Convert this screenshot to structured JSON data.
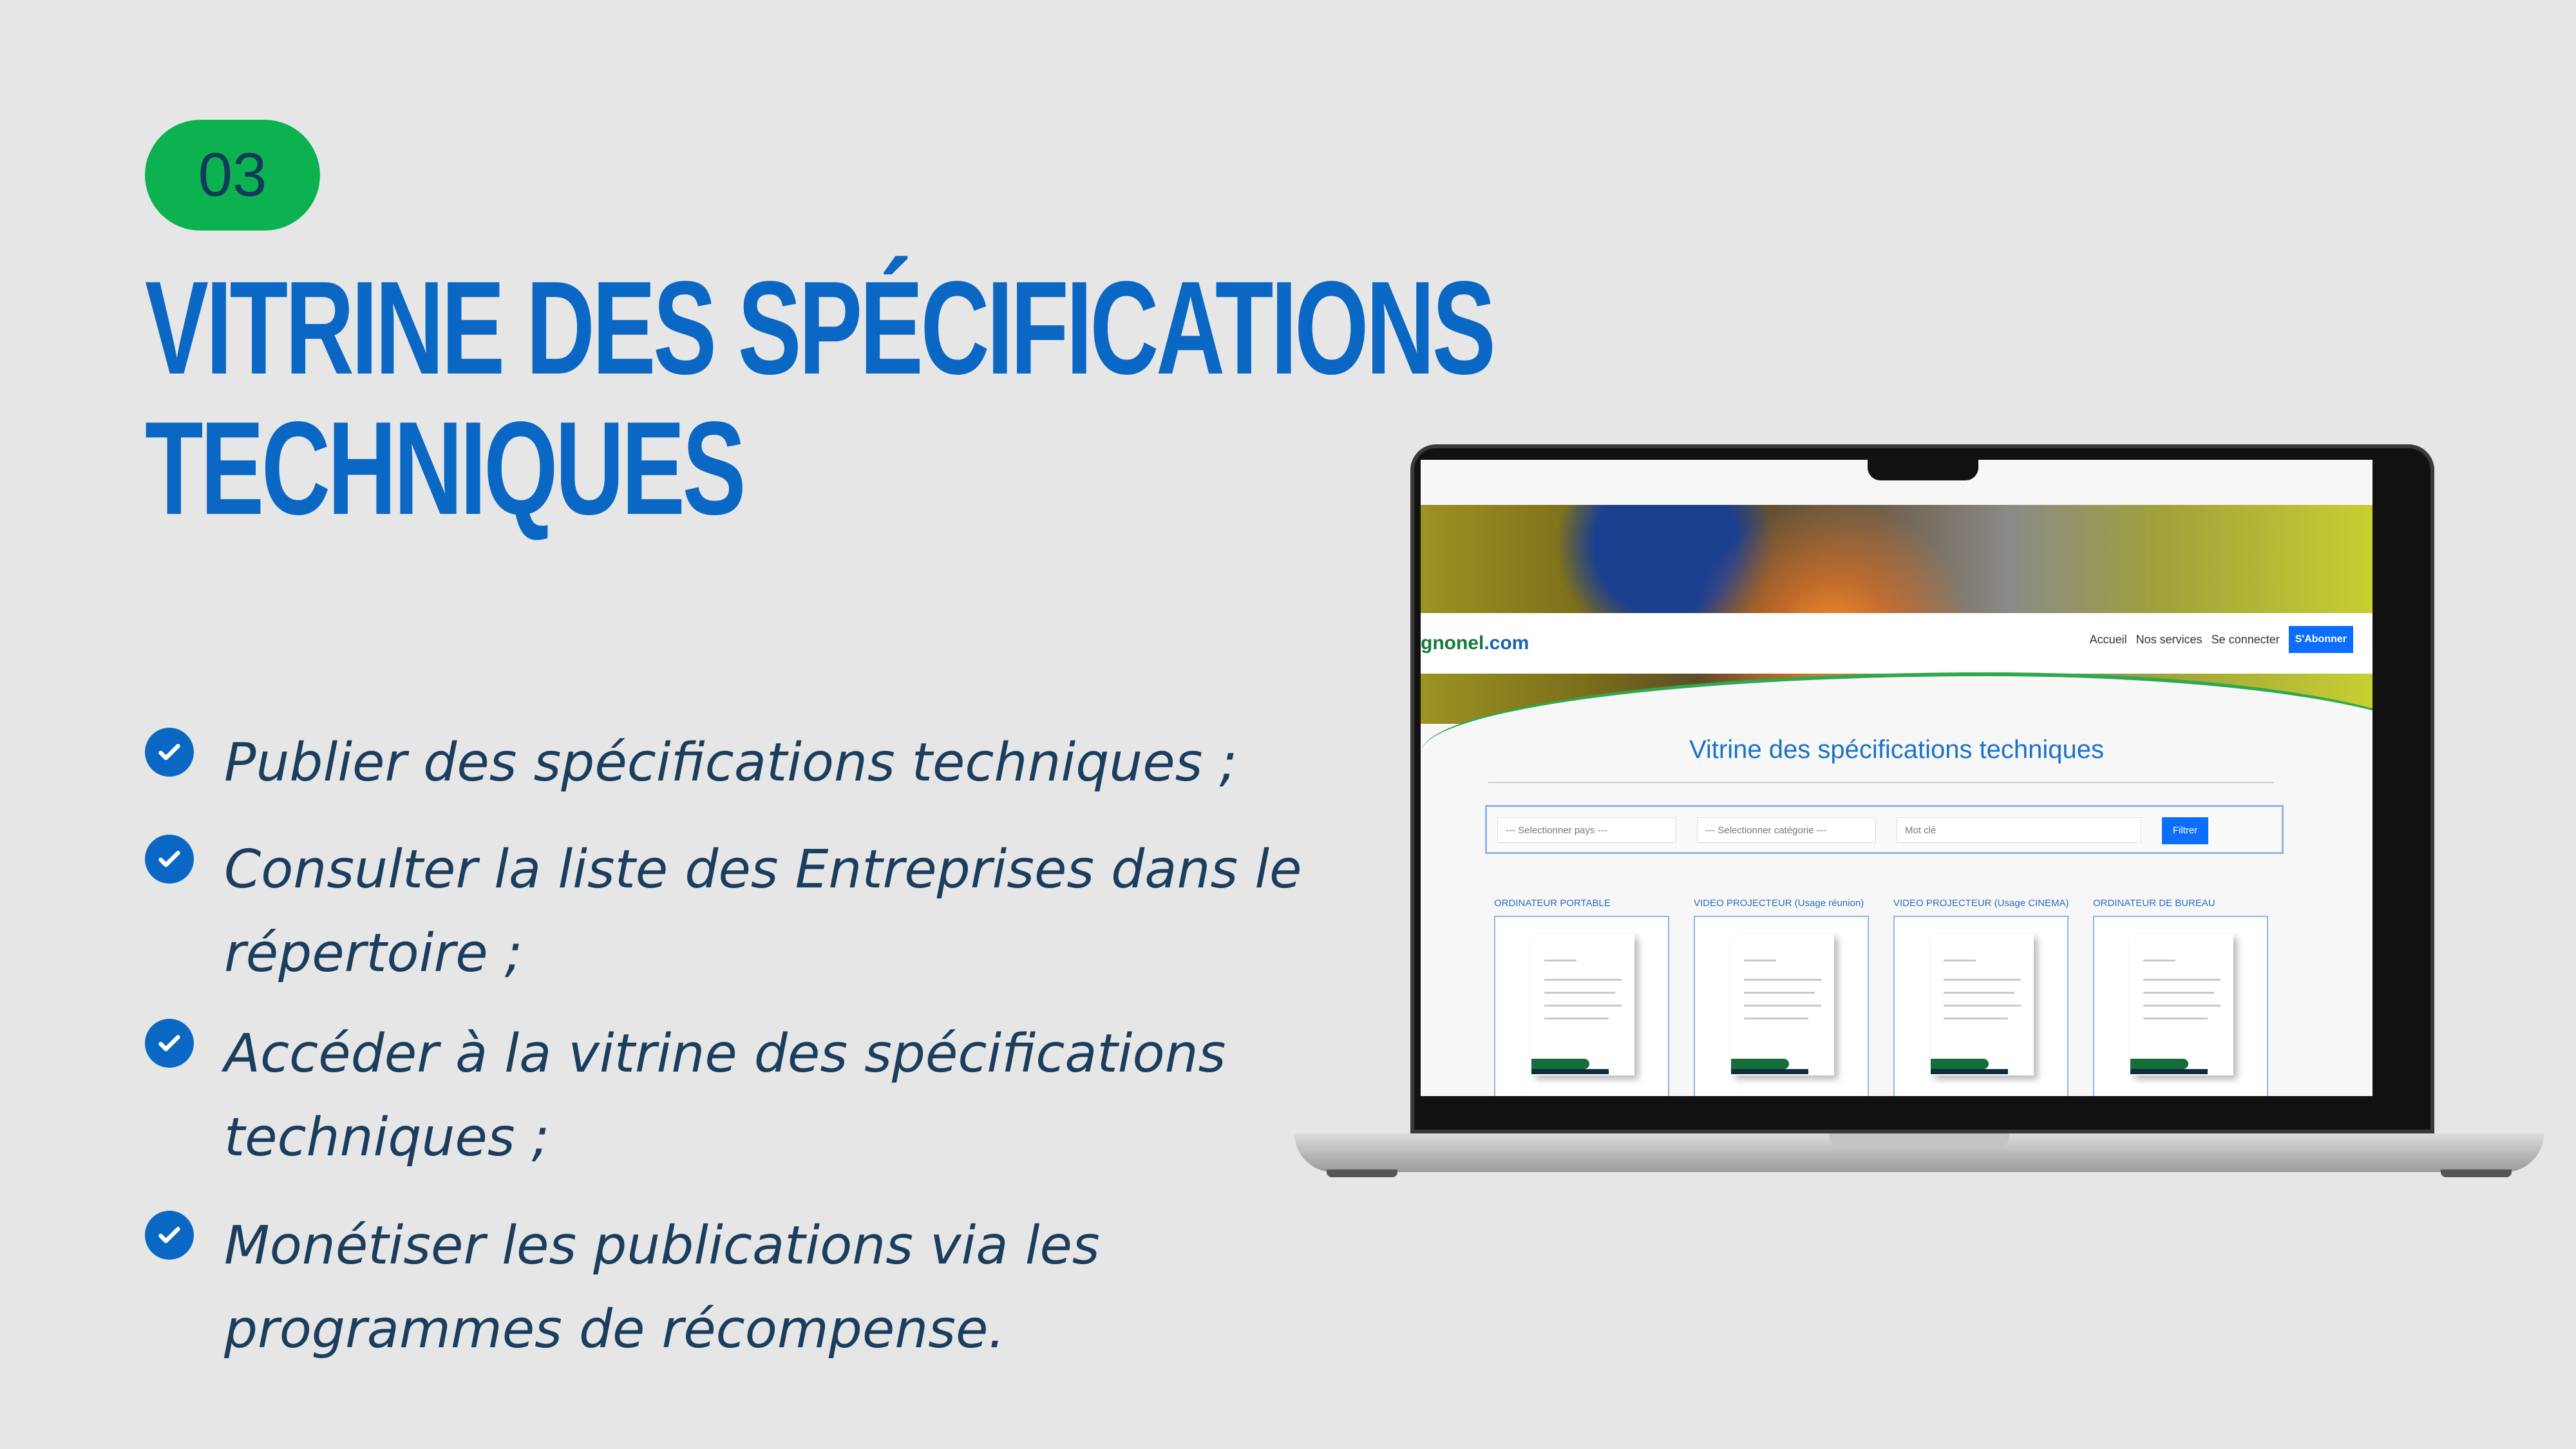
{
  "slide": {
    "number": "03",
    "title_line1": "VITRINE DES SPÉCIFICATIONS",
    "title_line2": "TECHNIQUES",
    "bullets": [
      "Publier des spécifications techniques ;",
      "Consulter la liste des Entreprises dans le répertoire ;",
      "Accéder à la vitrine des spécifications techniques ;",
      "Monétiser les publications via les programmes de récompense."
    ]
  },
  "website": {
    "logo_green": "gnonel",
    "logo_blue": ".com",
    "nav": {
      "home": "Accueil",
      "services": "Nos services",
      "login": "Se connecter",
      "subscribe": "S'Abonner"
    },
    "heading": "Vitrine des spécifications techniques",
    "filters": {
      "country": "--- Selectionner pays ---",
      "category": "--- Selectionner catégorie ---",
      "keyword": "Mot clé",
      "button": "Filtrer"
    },
    "cards": [
      "ORDINATEUR PORTABLE",
      "VIDEO PROJECTEUR (Usage réunion)",
      "VIDEO PROJECTEUR (Usage CINEMA)",
      "ORDINATEUR DE BUREAU"
    ]
  },
  "colors": {
    "background": "#e6e6e6",
    "badge": "#0cb24f",
    "title": "#0a68c4",
    "bullet_text": "#1b3d5e",
    "primary_button": "#0d6efd"
  },
  "icons": [
    "check-circle-icon"
  ]
}
